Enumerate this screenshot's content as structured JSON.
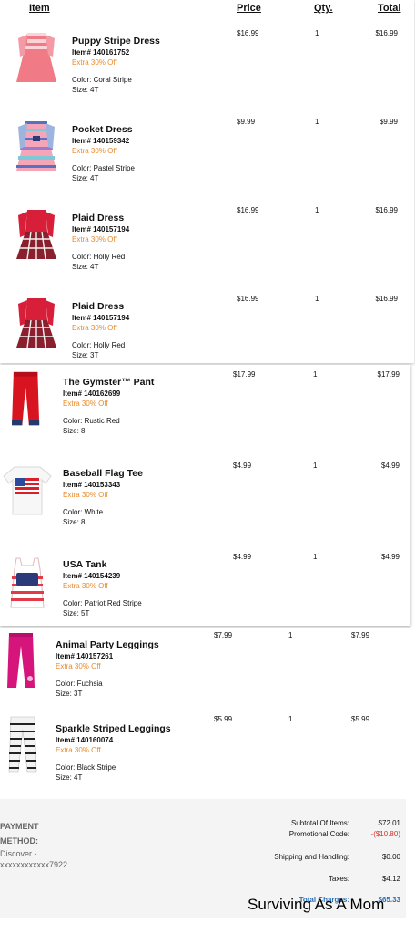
{
  "header": {
    "item": "Item",
    "price": "Price",
    "qty": "Qty.",
    "total": "Total"
  },
  "items": [
    {
      "name": "Puppy Stripe Dress",
      "item_no": "Item# 140161752",
      "promo": "Extra 30% Off",
      "color": "Color: Coral Stripe",
      "size": "Size: 4T",
      "price": "$16.99",
      "qty": "1",
      "total": "$16.99"
    },
    {
      "name": "Pocket Dress",
      "item_no": "Item# 140159342",
      "promo": "Extra 30% Off",
      "color": "Color: Pastel Stripe",
      "size": "Size: 4T",
      "price": "$9.99",
      "qty": "1",
      "total": "$9.99"
    },
    {
      "name": "Plaid Dress",
      "item_no": "Item# 140157194",
      "promo": "Extra 30% Off",
      "color": "Color: Holly Red",
      "size": "Size: 4T",
      "price": "$16.99",
      "qty": "1",
      "total": "$16.99"
    },
    {
      "name": "Plaid Dress",
      "item_no": "Item# 140157194",
      "promo": "Extra 30% Off",
      "color": "Color: Holly Red",
      "size": "Size: 3T",
      "price": "$16.99",
      "qty": "1",
      "total": "$16.99"
    },
    {
      "name": "The Gymster™ Pant",
      "item_no": "Item# 140162699",
      "promo": "Extra 30% Off",
      "color": "Color: Rustic Red",
      "size": "Size: 8",
      "price": "$17.99",
      "qty": "1",
      "total": "$17.99"
    },
    {
      "name": "Baseball Flag Tee",
      "item_no": "Item# 140153343",
      "promo": "Extra 30% Off",
      "color": "Color: White",
      "size": "Size: 8",
      "price": "$4.99",
      "qty": "1",
      "total": "$4.99"
    },
    {
      "name": "USA Tank",
      "item_no": "Item# 140154239",
      "promo": "Extra 30% Off",
      "color": "Color: Patriot Red Stripe",
      "size": "Size: 5T",
      "price": "$4.99",
      "qty": "1",
      "total": "$4.99"
    },
    {
      "name": "Animal Party Leggings",
      "item_no": "Item# 140157261",
      "promo": "Extra 30% Off",
      "color": "Color: Fuchsia",
      "size": "Size: 3T",
      "price": "$7.99",
      "qty": "1",
      "total": "$7.99"
    },
    {
      "name": "Sparkle Striped Leggings",
      "item_no": "Item# 140160074",
      "promo": "Extra 30% Off",
      "color": "Color: Black Stripe",
      "size": "Size: 4T",
      "price": "$5.99",
      "qty": "1",
      "total": "$5.99"
    }
  ],
  "payment": {
    "title_1": "PAYMENT",
    "title_2": "METHOD:",
    "method": "Discover -",
    "card": "xxxxxxxxxxxx7922"
  },
  "summary": {
    "subtotal_label": "Subtotal Of Items:",
    "subtotal": "$72.01",
    "promo_label": "Promotional Code:",
    "promo": "-($10.80)",
    "shipping_label": "Shipping and Handling:",
    "shipping": "$0.00",
    "taxes_label": "Taxes:",
    "taxes": "$4.12",
    "total_label": "Total Charges:",
    "total": "$65.33"
  },
  "watermark": "Surviving As A Mom",
  "colors": {
    "promo": "#e88a2c",
    "discount": "#d4322c",
    "total": "#2d6fb5"
  }
}
